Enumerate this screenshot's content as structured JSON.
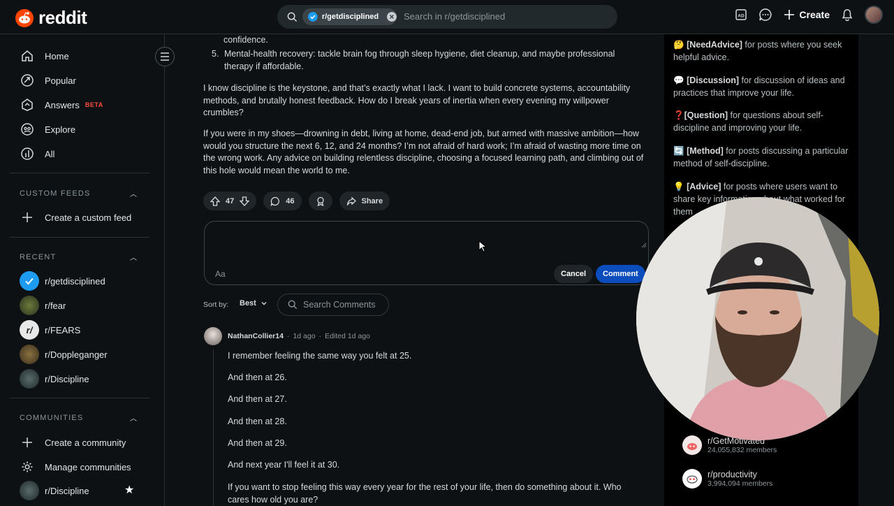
{
  "topbar": {
    "brand": "reddit",
    "search_chip": "r/getdisciplined",
    "search_placeholder": "Search in r/getdisciplined",
    "create_label": "Create"
  },
  "sidebar": {
    "nav": [
      {
        "label": "Home",
        "icon": "home-icon"
      },
      {
        "label": "Popular",
        "icon": "popular-icon"
      },
      {
        "label": "Answers",
        "icon": "answers-icon",
        "badge": "BETA"
      },
      {
        "label": "Explore",
        "icon": "explore-icon"
      },
      {
        "label": "All",
        "icon": "all-icon"
      }
    ],
    "custom_feeds_title": "CUSTOM FEEDS",
    "create_custom_feed": "Create a custom feed",
    "recent_title": "RECENT",
    "recent": [
      {
        "label": "r/getdisciplined",
        "color": "#1d9bf0"
      },
      {
        "label": "r/fear",
        "color": "#3b4a2a"
      },
      {
        "label": "r/FEARS",
        "color": "#e8e8e8"
      },
      {
        "label": "r/Doppleganger",
        "color": "#5a4a2e"
      },
      {
        "label": "r/Discipline",
        "color": "#2b3a3a"
      }
    ],
    "communities_title": "COMMUNITIES",
    "create_community": "Create a community",
    "manage_communities": "Manage communities",
    "community_fav": "r/Discipline"
  },
  "post": {
    "top_fragment": "confidence.",
    "list_item_5": "Mental-health recovery: tackle brain fog through sleep hygiene, diet cleanup, and maybe professional therapy if affordable.",
    "para1": "I know discipline is the keystone, and that’s exactly what I lack. I want to build concrete systems, accountability methods, and brutally honest feedback. How do I break years of inertia when every evening my willpower crumbles?",
    "para2": "If you were in my shoes—drowning in debt, living at home, dead-end job, but armed with massive ambition—how would you structure the next 6, 12, and 24 months? I’m not afraid of hard work; I’m afraid of wasting more time on the wrong work. Any advice on building relentless discipline, choosing a focused learning path, and climbing out of this hole would mean the world to me.",
    "votes": "47",
    "comments": "46",
    "share": "Share"
  },
  "composer": {
    "aa": "Aa",
    "cancel": "Cancel",
    "comment": "Comment"
  },
  "sort": {
    "label": "Sort by:",
    "value": "Best",
    "search_comments": "Search Comments"
  },
  "comment": {
    "author": "NathanCollier14",
    "age": "1d ago",
    "edited": "Edited 1d ago",
    "lines": [
      "I remember feeling the same way you felt at 25.",
      "And then at 26.",
      "And then at 27.",
      "And then at 28.",
      "And then at 29.",
      "And next year I'll feel it at 30.",
      "If you want to stop feeling this way every year for the rest of your life, then do something about it. Who cares how old you are?"
    ]
  },
  "rules": [
    {
      "emoji": "🤔",
      "tag": "[NeedAdvice]",
      "text": " for posts where you seek helpful advice."
    },
    {
      "emoji": "💬",
      "tag": "[Discussion]",
      "text": " for discussion of ideas and practices that improve your life."
    },
    {
      "emoji": "❓",
      "tag": "[Question]",
      "text": " for questions about self-discipline and improving your life."
    },
    {
      "emoji": "🔄",
      "tag": "[Method]",
      "text": " for posts discussing a particular method of self-discipline."
    },
    {
      "emoji": "💡",
      "tag": "[Advice]",
      "text": " for posts where users want to share key information about what worked for them"
    }
  ],
  "related": [
    {
      "name": "r/GetMotivated",
      "members": "24,055,832 members"
    },
    {
      "name": "r/productivity",
      "members": "3,994,094 members"
    }
  ]
}
